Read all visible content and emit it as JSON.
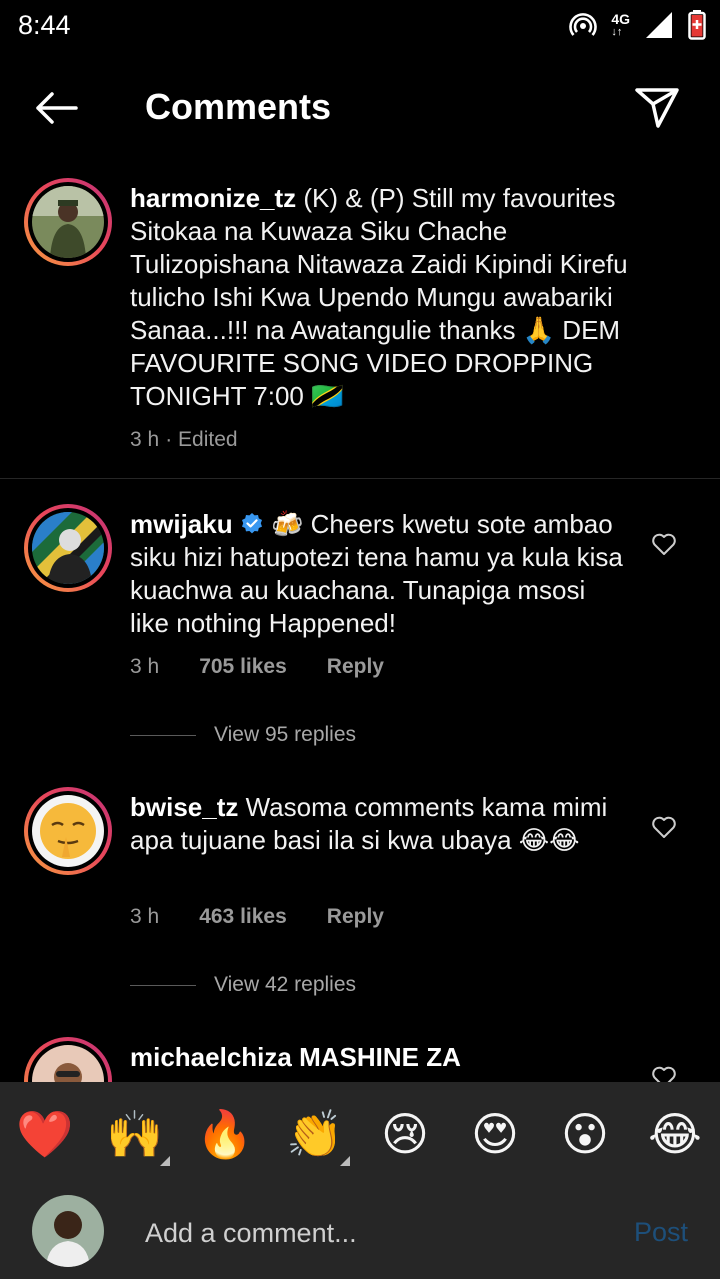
{
  "status_bar": {
    "time": "8:44",
    "network": "4G",
    "icons": [
      "hotspot-icon",
      "signal-icon",
      "battery-icon"
    ]
  },
  "header": {
    "title": "Comments",
    "back_icon": "arrow-left-icon",
    "share_icon": "paper-plane-icon"
  },
  "comments": [
    {
      "username": "harmonize_tz",
      "text": "(K) & (P) Still my favourites Sitokaa na Kuwaza Siku Chache Tulizopishana Nitawaza Zaidi Kipindi Kirefu tulicho Ishi Kwa Upendo Mungu awabariki Sanaa...!!! na Awatangulie thanks 🙏 DEM FAVOURITE SONG VIDEO DROPPING TONIGHT 7:00 🇹🇿",
      "time": "3 h",
      "edited": "· Edited"
    },
    {
      "username": "mwijaku",
      "verified": true,
      "text": "🍻 Cheers kwetu sote ambao siku hizi hatupotezi tena hamu ya kula kisa kuachwa au kuachana. Tunapiga msosi like nothing Happened!",
      "time": "3 h",
      "likes": "705 likes",
      "reply": "Reply",
      "view_replies": "View 95 replies"
    },
    {
      "username": "bwise_tz",
      "text": "Wasoma comments kama mimi apa tujuane basi ila si kwa ubaya 😂😂",
      "time": "3 h",
      "likes": "463 likes",
      "reply": "Reply",
      "view_replies": "View 42 replies"
    },
    {
      "username": "michaelchiza",
      "text": "MASHINE ZA"
    }
  ],
  "reactions": [
    "❤️",
    "🙌",
    "🔥",
    "👏",
    "😢",
    "😍",
    "😮",
    "😂"
  ],
  "composer": {
    "placeholder": "Add a comment...",
    "post_label": "Post"
  },
  "colors": {
    "background": "#000000",
    "panel": "#262626",
    "post_disabled": "#1d4f7a",
    "verified": "#3897f0",
    "ring_start": "#f9a03f",
    "ring_end": "#c0307a"
  }
}
